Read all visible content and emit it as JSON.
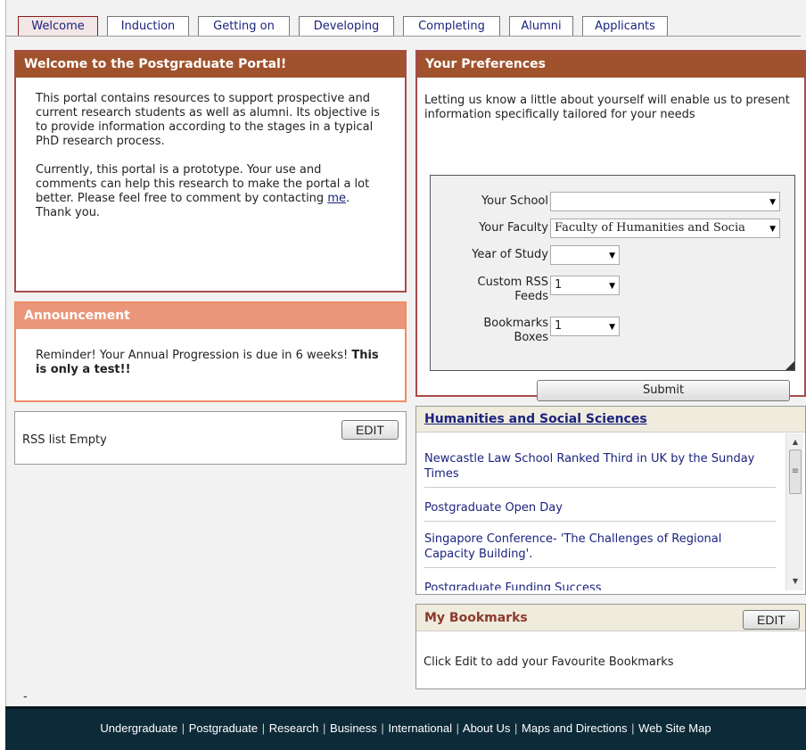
{
  "tabs": [
    {
      "label": "Welcome"
    },
    {
      "label": "Induction"
    },
    {
      "label": "Getting on"
    },
    {
      "label": "Developing"
    },
    {
      "label": "Completing"
    },
    {
      "label": "Alumni"
    },
    {
      "label": "Applicants"
    }
  ],
  "welcome": {
    "title": "Welcome to the Postgraduate Portal!",
    "para1": "This portal contains resources to support prospective and current research students as well as alumni. Its objective is to provide information according to the stages in a typical PhD research process.",
    "para2_before": "Currently, this portal is a prototype. Your use and comments can help this research to make the portal a lot better. Please feel free to comment by contacting ",
    "para2_link": "me",
    "para2_after": ". Thank you."
  },
  "announcement": {
    "title": "Announcement",
    "text": "Reminder! Your Annual Progression is due in 6 weeks! ",
    "bold": "This is only a test!!"
  },
  "rss": {
    "text": "RSS list Empty",
    "edit_label": "EDIT"
  },
  "preferences": {
    "title": "Your Preferences",
    "intro": "Letting us know a little about yourself will enable us to present information specifically tailored for your needs",
    "school_label": "Your School",
    "school_value": "",
    "faculty_label": "Your Faculty",
    "faculty_value": "Faculty of Humanities and Socia",
    "year_label": "Year of Study",
    "year_value": "",
    "rss_label_1": "Custom RSS",
    "rss_label_2": "Feeds",
    "rss_value": "1",
    "bookmarks_label_1": "Bookmarks",
    "bookmarks_label_2": "Boxes",
    "bookmarks_value": "1",
    "submit_label": "Submit"
  },
  "news": {
    "title": "Humanities and Social Sciences",
    "items": [
      "Newcastle Law School Ranked Third in UK by the Sunday Times",
      "Postgraduate Open Day",
      "Singapore Conference- 'The Challenges of Regional Capacity Building'.",
      "Postgraduate Funding Success"
    ]
  },
  "bookmarks": {
    "title": "My Bookmarks",
    "edit_label": "EDIT",
    "text": "Click Edit to add your Favourite Bookmarks"
  },
  "misc": {
    "dash": "-"
  },
  "footer": {
    "links": [
      "Undergraduate",
      "Postgraduate",
      "Research",
      "Business",
      "International",
      "About Us",
      "Maps and Directions",
      "Web Site Map"
    ],
    "separator": "|"
  }
}
